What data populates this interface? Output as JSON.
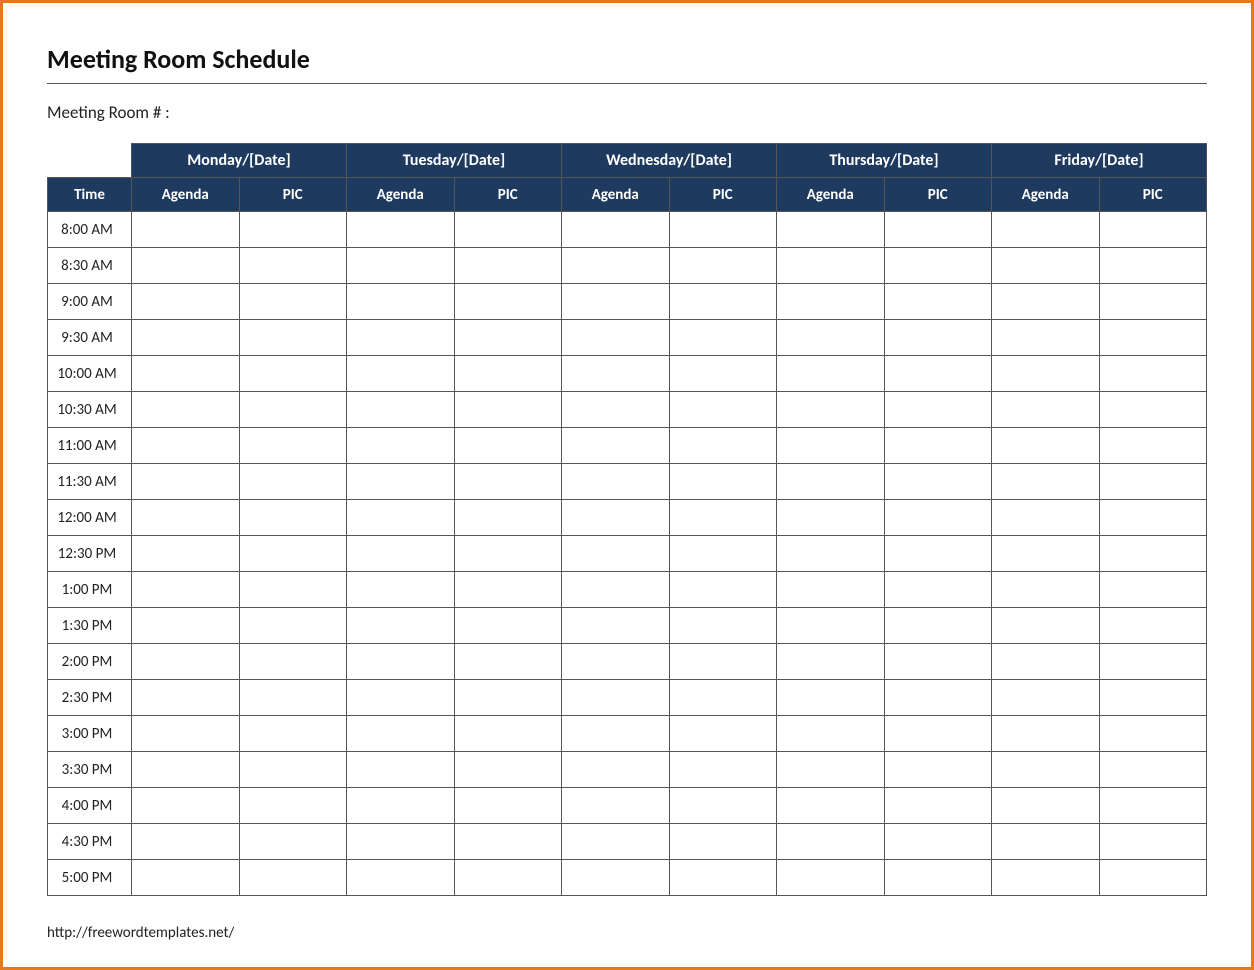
{
  "title": "Meeting Room Schedule",
  "room_label": "Meeting Room # :",
  "columns": {
    "time": "Time",
    "agenda": "Agenda",
    "pic": "PIC"
  },
  "days": [
    "Monday/[Date]",
    "Tuesday/[Date]",
    "Wednesday/[Date]",
    "Thursday/[Date]",
    "Friday/[Date]"
  ],
  "times": [
    "8:00 AM",
    "8:30 AM",
    "9:00 AM",
    "9:30 AM",
    "10:00 AM",
    "10:30 AM",
    "11:00 AM",
    "11:30 AM",
    "12:00 AM",
    "12:30 PM",
    "1:00 PM",
    "1:30 PM",
    "2:00 PM",
    "2:30 PM",
    "3:00 PM",
    "3:30 PM",
    "4:00 PM",
    "4:30 PM",
    "5:00 PM"
  ],
  "footer_url": "http://freewordtemplates.net/"
}
